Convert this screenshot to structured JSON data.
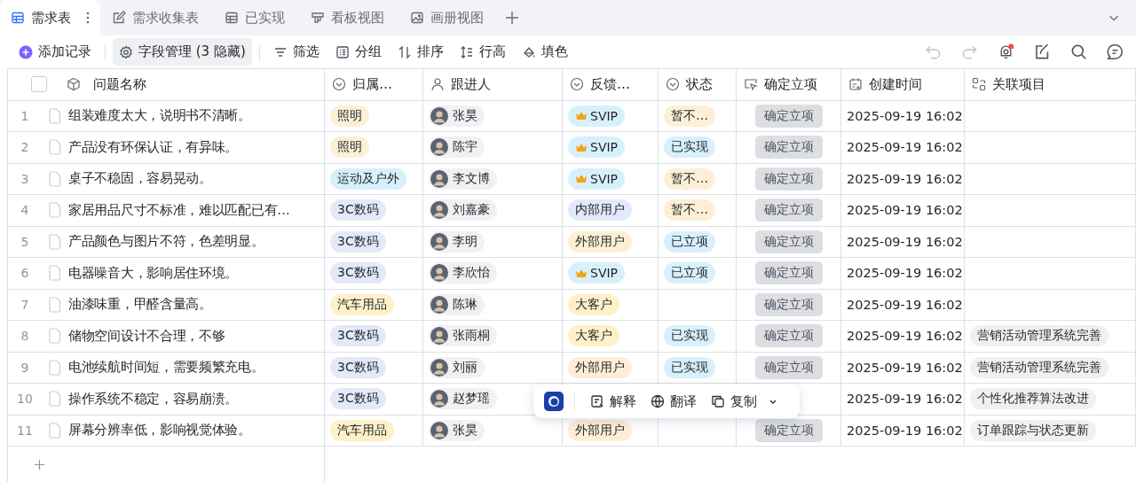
{
  "tabs": [
    {
      "label": "需求表",
      "selected": true
    },
    {
      "label": "需求收集表",
      "selected": false
    },
    {
      "label": "已实现",
      "selected": false
    },
    {
      "label": "看板视图",
      "selected": false
    },
    {
      "label": "画册视图",
      "selected": false
    }
  ],
  "toolbar": {
    "add": "添加记录",
    "items": [
      "字段管理 (3 隐藏)",
      "筛选",
      "分组",
      "排序",
      "行高",
      "填色"
    ],
    "notification": true
  },
  "table": {
    "select_all": {
      "checked": false
    },
    "columns": [
      "问题名称",
      "归属…",
      "跟进人",
      "反馈…",
      "状态",
      "确定立项",
      "创建时间",
      "关联项目"
    ],
    "rows": [
      {
        "num": "1",
        "title": "组装难度太大，说明书不清晰。",
        "category": {
          "label": "照明",
          "color": "#fdefd6"
        },
        "owner": "张昊",
        "feedback": {
          "label": "SVIP",
          "color": "#d8f0fb",
          "kind": "vip"
        },
        "status": {
          "label": "暂不…",
          "color": "#fdefd6"
        },
        "action": {
          "label": "确定立项",
          "disabled": true
        },
        "created": "2025-09-19 16:02"
      },
      {
        "num": "2",
        "title": "产品没有环保认证，有异味。",
        "category": {
          "label": "照明",
          "color": "#fdefd6"
        },
        "owner": "陈宇",
        "feedback": {
          "label": "SVIP",
          "color": "#d8f0fb",
          "kind": "vip"
        },
        "status": {
          "label": "已实现",
          "color": "#d8f0fb"
        },
        "action": {
          "label": "确定立项",
          "disabled": true
        },
        "created": "2025-09-19 16:02"
      },
      {
        "num": "3",
        "title": "桌子不稳固，容易晃动。",
        "category": {
          "label": "运动及户外",
          "color": "#d8f0fb"
        },
        "owner": "李文博",
        "feedback": {
          "label": "SVIP",
          "color": "#d8f0fb",
          "kind": "vip"
        },
        "status": {
          "label": "暂不…",
          "color": "#fdefd6"
        },
        "action": {
          "label": "确定立项",
          "disabled": true
        },
        "created": "2025-09-19 16:02"
      },
      {
        "num": "4",
        "title": "家居用品尺寸不标准，难以匹配已有…",
        "category": {
          "label": "3C数码",
          "color": "#e2e9f8"
        },
        "owner": "刘嘉豪",
        "feedback": {
          "label": "内部用户",
          "color": "#e2e9f8",
          "kind": "plain"
        },
        "status": {
          "label": "暂不…",
          "color": "#fdefd6"
        },
        "action": {
          "label": "确定立项",
          "disabled": true
        },
        "created": "2025-09-19 16:02"
      },
      {
        "num": "5",
        "title": "产品颜色与图片不符，色差明显。",
        "category": {
          "label": "3C数码",
          "color": "#e2e9f8"
        },
        "owner": "李明",
        "feedback": {
          "label": "外部用户",
          "color": "#fdefd6",
          "kind": "plain"
        },
        "status": {
          "label": "已立项",
          "color": "#d8f0fb"
        },
        "action": {
          "label": "确定立项",
          "disabled": true
        },
        "created": "2025-09-19 16:02"
      },
      {
        "num": "6",
        "title": "电器噪音大，影响居住环境。",
        "category": {
          "label": "3C数码",
          "color": "#e2e9f8"
        },
        "owner": "李欣怡",
        "feedback": {
          "label": "SVIP",
          "color": "#d8f0fb",
          "kind": "vip"
        },
        "status": {
          "label": "已立项",
          "color": "#d8f0fb"
        },
        "action": {
          "label": "确定立项",
          "disabled": true
        },
        "created": "2025-09-19 16:02"
      },
      {
        "num": "7",
        "title": "油漆味重，甲醛含量高。",
        "category": {
          "label": "汽车用品",
          "color": "#fdf1c8"
        },
        "owner": "陈琳",
        "feedback": {
          "label": "大客户",
          "color": "#fdf1c8",
          "kind": "plain"
        },
        "action": {
          "label": "确定立项",
          "disabled": true
        },
        "created": "2025-09-19 16:02"
      },
      {
        "num": "8",
        "title": "储物空间设计不合理，不够",
        "category": {
          "label": "3C数码",
          "color": "#e2e9f8"
        },
        "owner": "张雨桐",
        "feedback": {
          "label": "大客户",
          "color": "#fdf1c8",
          "kind": "plain"
        },
        "status": {
          "label": "已实现",
          "color": "#d8f0fb"
        },
        "action": {
          "label": "确定立项",
          "disabled": true
        },
        "created": "2025-09-19 16:02",
        "related": "营销活动管理系统完善"
      },
      {
        "num": "9",
        "title": "电池续航时间短，需要频繁充电。",
        "category": {
          "label": "3C数码",
          "color": "#e2e9f8"
        },
        "owner": "刘丽",
        "feedback": {
          "label": "外部用户",
          "color": "#fdefd6",
          "kind": "plain"
        },
        "status": {
          "label": "已实现",
          "color": "#d8f0fb"
        },
        "action": {
          "label": "确定立项",
          "disabled": true
        },
        "created": "2025-09-19 16:02",
        "related": "营销活动管理系统完善"
      },
      {
        "num": "10",
        "title": "操作系统不稳定，容易崩溃。",
        "category": {
          "label": "3C数码",
          "color": "#e2e9f8"
        },
        "owner": "赵梦瑶",
        "created": "2025-09-19 16:02",
        "related": "个性化推荐算法改进"
      },
      {
        "num": "11",
        "title": "屏幕分辨率低，影响视觉体验。",
        "category": {
          "label": "汽车用品",
          "color": "#fdf1c8"
        },
        "owner": "张昊",
        "feedback": {
          "label": "外部用户",
          "color": "#fdefd6",
          "kind": "plain"
        },
        "action": {
          "label": "确定立项",
          "disabled": true
        },
        "created": "2025-09-19 16:02",
        "related": "订单跟踪与状态更新"
      }
    ]
  },
  "popup": {
    "items": [
      "解释",
      "翻译",
      "复制"
    ]
  }
}
